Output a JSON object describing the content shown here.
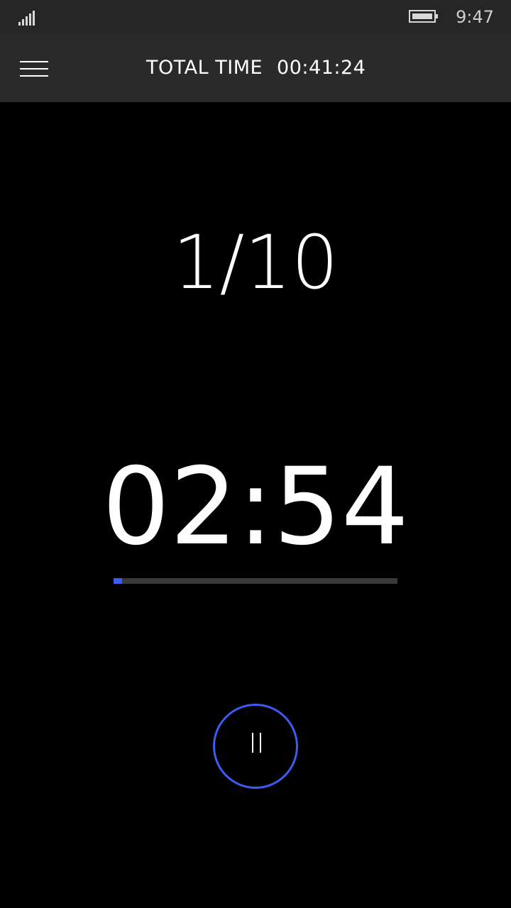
{
  "status_bar": {
    "time": "9:47",
    "signal_icon": "signal-strength-icon",
    "battery_icon": "battery-icon"
  },
  "header": {
    "menu_icon": "hamburger-menu-icon",
    "total_label": "TOTAL TIME",
    "total_value": "00:41:24"
  },
  "main": {
    "round": "1/10",
    "timer": "02:54",
    "progress_fraction": 0.03,
    "pause_icon": "pause-icon"
  },
  "colors": {
    "accent": "#3a5cf0",
    "background": "#000000",
    "header_bg": "#2a2a2a",
    "status_bg": "#262626"
  }
}
